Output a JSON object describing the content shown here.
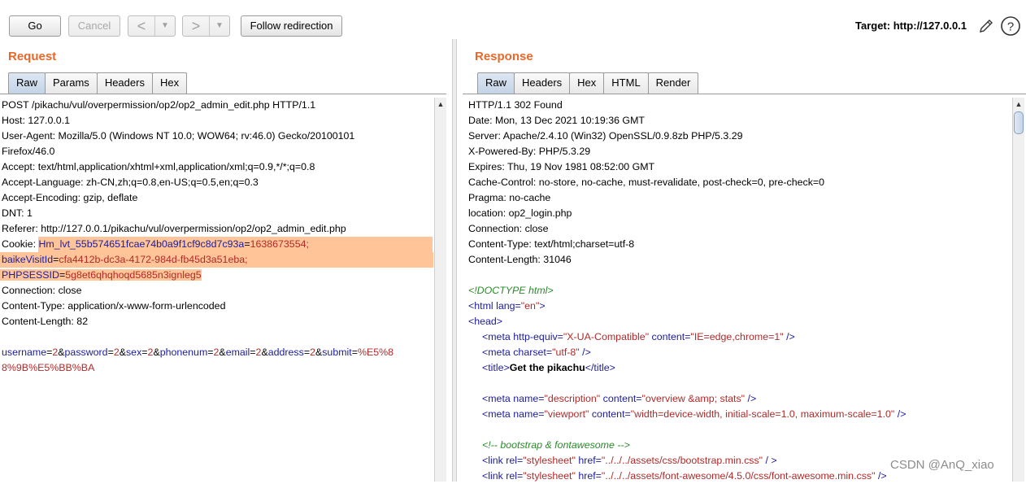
{
  "toolbar": {
    "go_label": "Go",
    "cancel_label": "Cancel",
    "back_arrow": "<",
    "forward_arrow": ">",
    "dropdown_glyph": "▼",
    "follow_label": "Follow redirection",
    "target_text": "Target: http://127.0.0.1"
  },
  "icons": {
    "edit": "pencil-icon",
    "help": "help-icon"
  },
  "request": {
    "title": "Request",
    "tabs": [
      "Raw",
      "Params",
      "Headers",
      "Hex"
    ],
    "active_tab": "Raw",
    "lines": [
      "POST /pikachu/vul/overpermission/op2/op2_admin_edit.php HTTP/1.1",
      "Host: 127.0.0.1",
      "User-Agent: Mozilla/5.0 (Windows NT 10.0; WOW64; rv:46.0) Gecko/20100101",
      "Firefox/46.0",
      "Accept: text/html,application/xhtml+xml,application/xml;q=0.9,*/*;q=0.8",
      "Accept-Language: zh-CN,zh;q=0.8,en-US;q=0.5,en;q=0.3",
      "Accept-Encoding: gzip, deflate",
      "DNT: 1",
      "Referer: http://127.0.0.1/pikachu/vul/overpermission/op2/op2_admin_edit.php"
    ],
    "cookie": {
      "label": "Cookie: ",
      "name1": "Hm_lvt_55b574651fcae74b0a9f1cf9c8d7c93a",
      "value1": "1638673554;",
      "name2": "baikeVisitId",
      "value2": "cfa4412b-dc3a-4172-984d-fb45d3a51eba;",
      "name3": "PHPSESSID",
      "value3": "5g8et6qhqhoqd5685n3ignleg5"
    },
    "lines_after": [
      "Connection: close",
      "Content-Type: application/x-www-form-urlencoded",
      "Content-Length: 82"
    ],
    "body": {
      "k1": "username",
      "v1": "2",
      "k2": "password",
      "v2": "2",
      "k3": "sex",
      "v3": "2",
      "k4": "phonenum",
      "v4": "2",
      "k5": "email",
      "v5": "2",
      "k6": "address",
      "v6": "2",
      "k7": "submit",
      "v7a": "%E5%8",
      "v7b": "8%9B%E5%BB%BA"
    }
  },
  "response": {
    "title": "Response",
    "tabs": [
      "Raw",
      "Headers",
      "Hex",
      "HTML",
      "Render"
    ],
    "active_tab": "Raw",
    "headers": [
      "HTTP/1.1 302 Found",
      "Date: Mon, 13 Dec 2021 10:19:36 GMT",
      "Server: Apache/2.4.10 (Win32) OpenSSL/0.9.8zb PHP/5.3.29",
      "X-Powered-By: PHP/5.3.29",
      "Expires: Thu, 19 Nov 1981 08:52:00 GMT",
      "Cache-Control: no-store, no-cache, must-revalidate, post-check=0, pre-check=0",
      "Pragma: no-cache",
      "location: op2_login.php",
      "Connection: close",
      "Content-Type: text/html;charset=utf-8",
      "Content-Length: 31046"
    ],
    "html": {
      "doctype": "<!DOCTYPE html>",
      "html_open": "<html",
      "html_attr": " lang=",
      "html_attr_val": "\"en\"",
      "html_close": ">",
      "head": "<head>",
      "meta1_tag": "<meta",
      "meta1_a1": " http-equiv=",
      "meta1_v1": "\"X-UA-Compatible\"",
      "meta1_a2": " content=",
      "meta1_v2": "\"IE=edge,chrome=1\"",
      "meta1_end": " />",
      "meta2_tag": "<meta",
      "meta2_a1": " charset=",
      "meta2_v1": "\"utf-8\"",
      "meta2_end": " />",
      "title_open": "<title>",
      "title_text": "Get the pikachu",
      "title_close": "</title>",
      "meta3_tag": "<meta",
      "meta3_a1": " name=",
      "meta3_v1": "\"description\"",
      "meta3_a2": " content=",
      "meta3_v2": "\"overview &amp; stats\"",
      "meta3_end": " />",
      "meta4_tag": "<meta",
      "meta4_a1": " name=",
      "meta4_v1": "\"viewport\"",
      "meta4_a2": " content=",
      "meta4_v2": "\"width=device-width, initial-scale=1.0, maximum-scale=1.0\"",
      "meta4_end": " />",
      "comment": "<!-- bootstrap & fontawesome -->",
      "link1_tag": "<link",
      "link1_a1": " rel=",
      "link1_v1": "\"stylesheet\"",
      "link1_a2": " href=",
      "link1_v2": "\"../../../assets/css/bootstrap.min.css\"",
      "link1_end": " / >",
      "link2_tag": "<link",
      "link2_a1": " rel=",
      "link2_v1": "\"stylesheet\"",
      "link2_a2": " href=",
      "link2_v2": "\"../../../assets/font-awesome/4.5.0/css/font-awesome.min.css\"",
      "link2_end": " />"
    }
  },
  "watermark": "CSDN @AnQ_xiao",
  "colors": {
    "section_title": "#e8682a",
    "cookie_highlight": "#ffc598",
    "tag_blue": "#1c1c9c",
    "value_red": "#b02a2a",
    "comment_green": "#2a8a2a"
  }
}
